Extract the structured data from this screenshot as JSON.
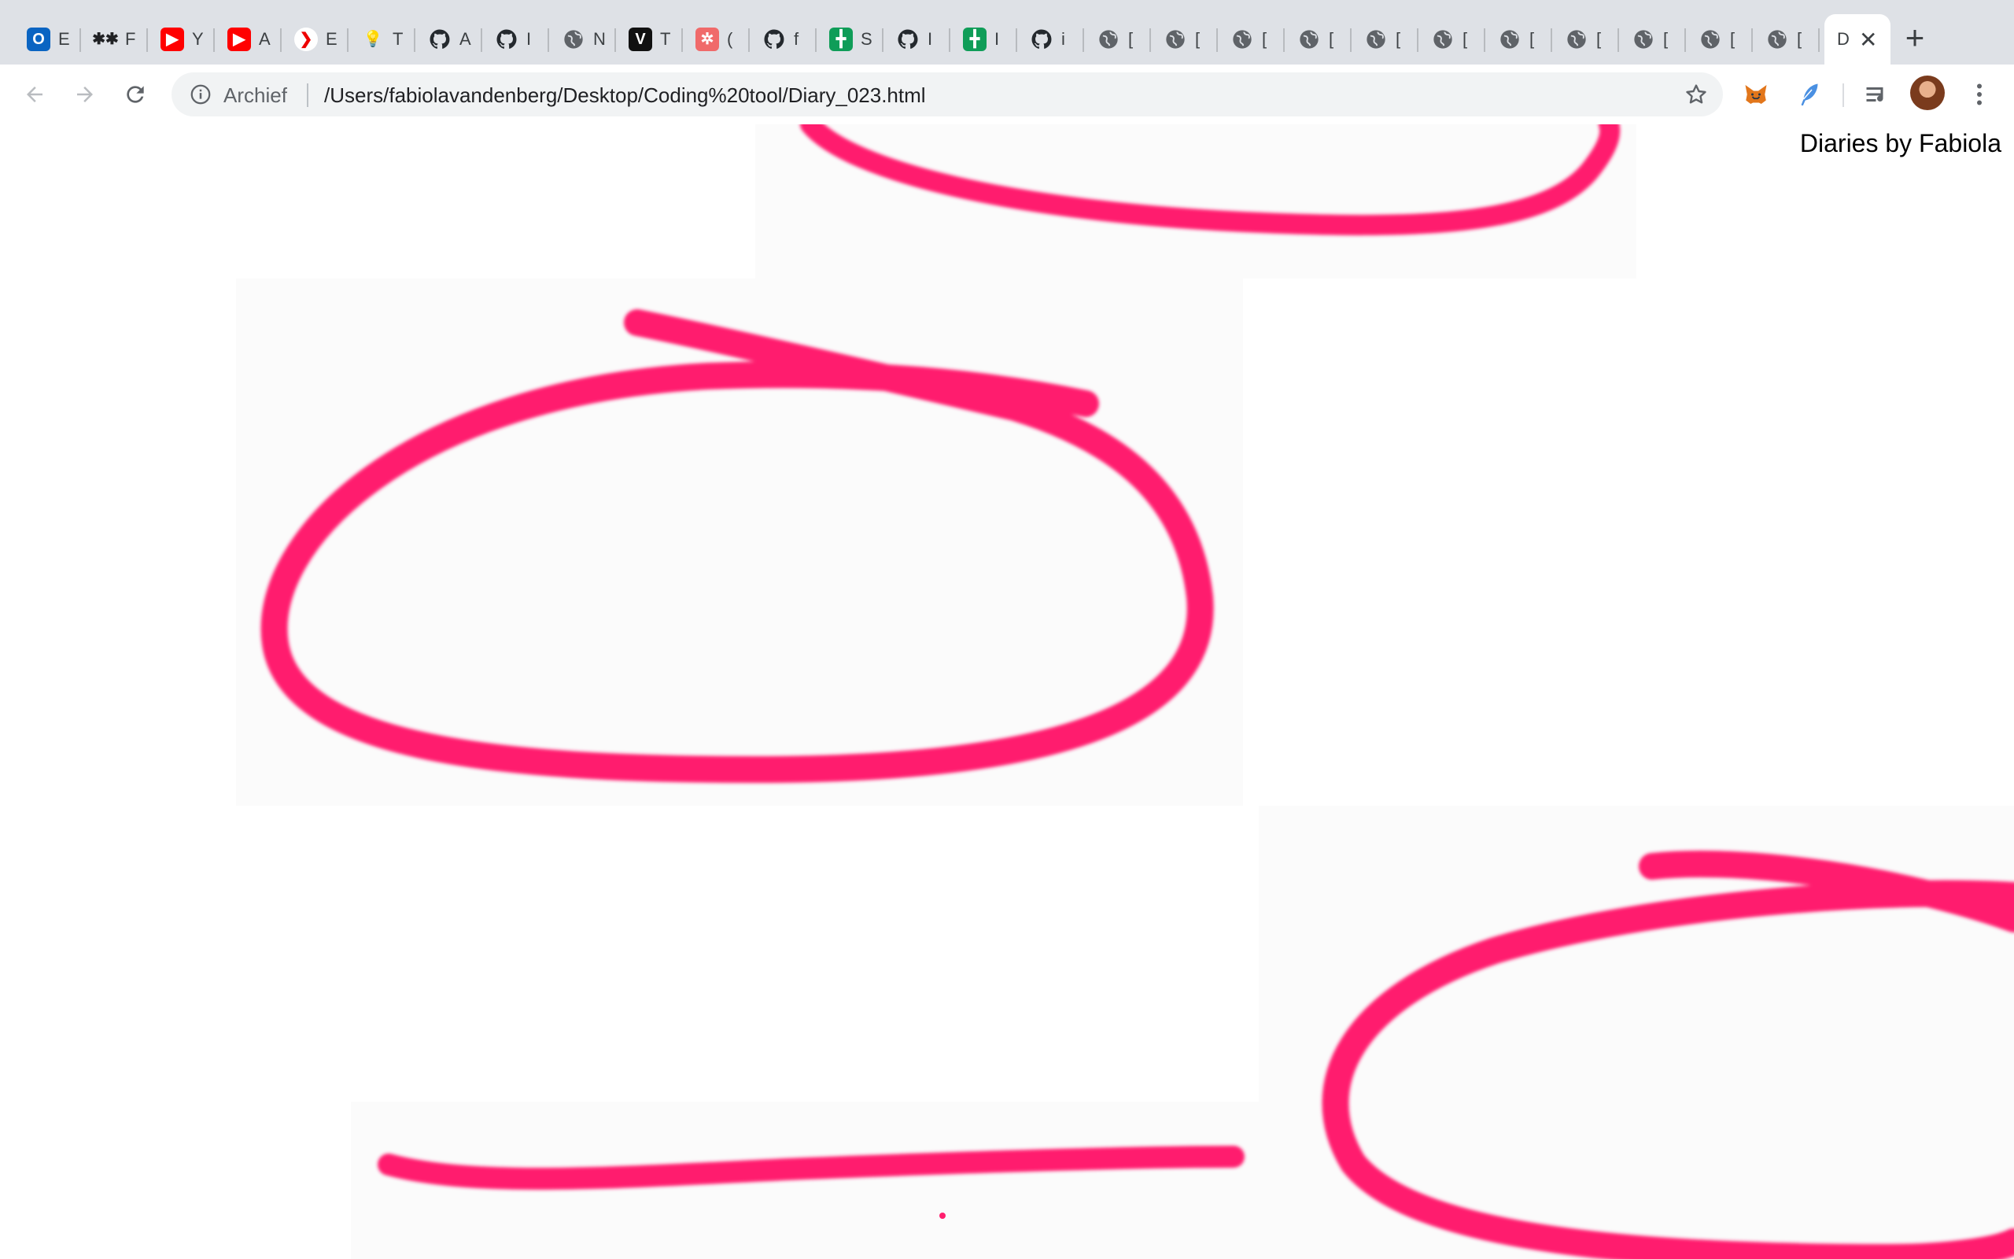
{
  "browser": {
    "tabs": [
      {
        "icon": "outlook-icon",
        "title": "E",
        "color": "#0a64c2",
        "glyph": "O"
      },
      {
        "icon": "asterisk-icon",
        "title": "F",
        "color": "none",
        "glyph": "✱✱"
      },
      {
        "icon": "youtube-icon",
        "title": "Y",
        "color": "#ff0000",
        "glyph": "▶"
      },
      {
        "icon": "youtube-icon",
        "title": "A",
        "color": "#ff0000",
        "glyph": "▶"
      },
      {
        "icon": "chevron-app-icon",
        "title": "E",
        "color": "#ffffff",
        "glyph": "❯"
      },
      {
        "icon": "lightbulb-icon",
        "title": "T",
        "color": "none",
        "glyph": "💡"
      },
      {
        "icon": "github-icon",
        "title": "A",
        "color": "none",
        "glyph": ""
      },
      {
        "icon": "github-icon",
        "title": "I",
        "color": "none",
        "glyph": ""
      },
      {
        "icon": "globe-icon",
        "title": "N",
        "color": "none",
        "glyph": ""
      },
      {
        "icon": "v-logo-icon",
        "title": "T",
        "color": "#111111",
        "glyph": "V"
      },
      {
        "icon": "asana-icon",
        "title": "(",
        "color": "#f06a6a",
        "glyph": "✲"
      },
      {
        "icon": "github-icon",
        "title": "f",
        "color": "none",
        "glyph": ""
      },
      {
        "icon": "sheets-icon",
        "title": "S",
        "color": "#0f9d58",
        "glyph": "╋"
      },
      {
        "icon": "github-icon",
        "title": "I",
        "color": "none",
        "glyph": ""
      },
      {
        "icon": "sheets-icon",
        "title": "I",
        "color": "#0f9d58",
        "glyph": "╋"
      },
      {
        "icon": "github-icon",
        "title": "i",
        "color": "none",
        "glyph": ""
      },
      {
        "icon": "globe-icon",
        "title": "[",
        "color": "none",
        "glyph": ""
      },
      {
        "icon": "globe-icon",
        "title": "[",
        "color": "none",
        "glyph": ""
      },
      {
        "icon": "globe-icon",
        "title": "[",
        "color": "none",
        "glyph": ""
      },
      {
        "icon": "globe-icon",
        "title": "[",
        "color": "none",
        "glyph": ""
      },
      {
        "icon": "globe-icon",
        "title": "[",
        "color": "none",
        "glyph": ""
      },
      {
        "icon": "globe-icon",
        "title": "[",
        "color": "none",
        "glyph": ""
      },
      {
        "icon": "globe-icon",
        "title": "[",
        "color": "none",
        "glyph": ""
      },
      {
        "icon": "globe-icon",
        "title": "[",
        "color": "none",
        "glyph": ""
      },
      {
        "icon": "globe-icon",
        "title": "[",
        "color": "none",
        "glyph": ""
      },
      {
        "icon": "globe-icon",
        "title": "[",
        "color": "none",
        "glyph": ""
      },
      {
        "icon": "globe-icon",
        "title": "[",
        "color": "none",
        "glyph": ""
      }
    ],
    "active_tab": {
      "title": "D",
      "close_glyph": "✕"
    },
    "new_tab_glyph": "+",
    "omnibox": {
      "security_label": "Archief",
      "url": "/Users/fabiolavandenberg/Desktop/Coding%20tool/Diary_023.html"
    },
    "extensions": [
      "metamask-fox-icon",
      "feather-icon",
      "media-playlist-icon",
      "avatar",
      "menu-dots-icon"
    ]
  },
  "page": {
    "brand": "Diaries by Fabiola",
    "stroke_color": "#ff1f6e"
  }
}
